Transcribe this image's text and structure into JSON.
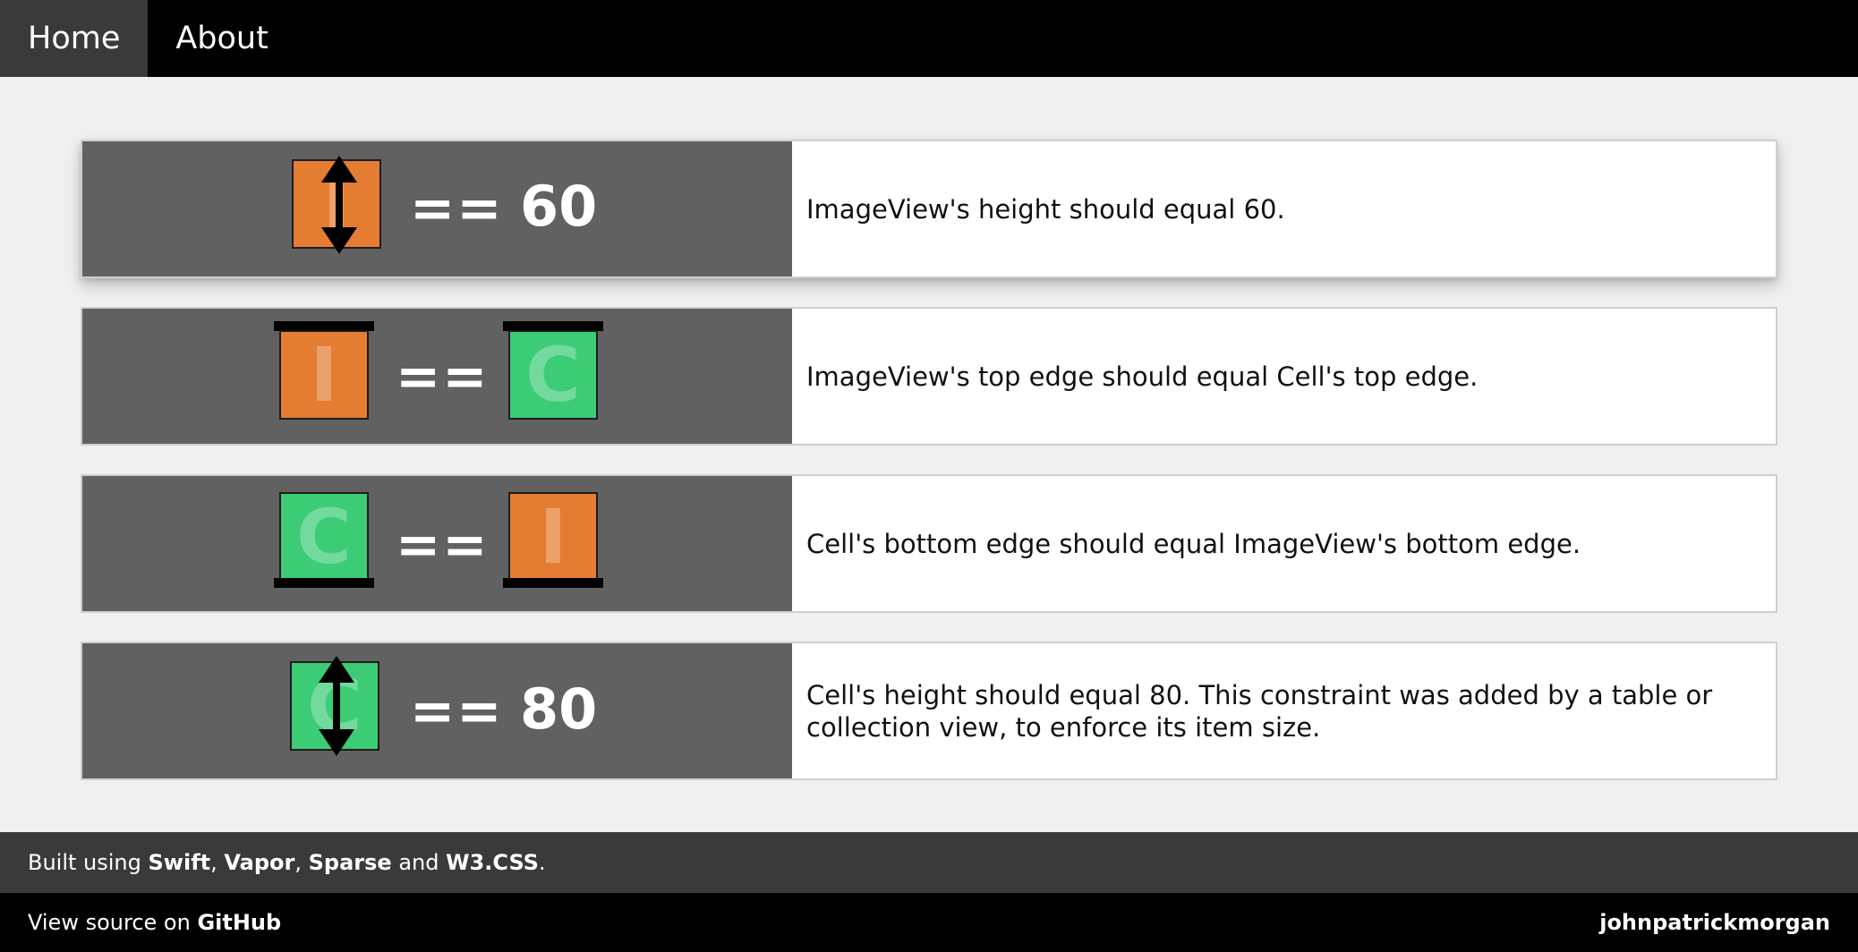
{
  "nav": {
    "home": "Home",
    "about": "About"
  },
  "constraints": [
    {
      "left_letter": "I",
      "operator": "==",
      "constant": "60",
      "description": "ImageView's height should equal 60."
    },
    {
      "left_letter": "I",
      "operator": "==",
      "right_letter": "C",
      "description": "ImageView's top edge should equal Cell's top edge."
    },
    {
      "left_letter": "C",
      "operator": "==",
      "right_letter": "I",
      "description": "Cell's bottom edge should equal ImageView's bottom edge."
    },
    {
      "left_letter": "C",
      "operator": "==",
      "constant": "80",
      "description": "Cell's height should equal 80. This constraint was added by a table or collection view, to enforce its item size."
    }
  ],
  "footer": {
    "built_prefix": "Built using ",
    "swift": "Swift",
    "sep1": ", ",
    "vapor": "Vapor",
    "sep2": ", ",
    "sparse": "Sparse",
    "and": " and ",
    "w3css": "W3.CSS",
    "period": ".",
    "view_source_prefix": "View source on ",
    "github": "GitHub",
    "author": "johnpatrickmorgan"
  },
  "colors": {
    "imageview_orange": "#e47d32",
    "cell_green": "#3ccc76",
    "visual_panel_gray": "#616161"
  },
  "icons": {
    "height_arrow": "double-vertical-arrow",
    "top_edge": "top-edge-bar",
    "bottom_edge": "bottom-edge-bar"
  }
}
